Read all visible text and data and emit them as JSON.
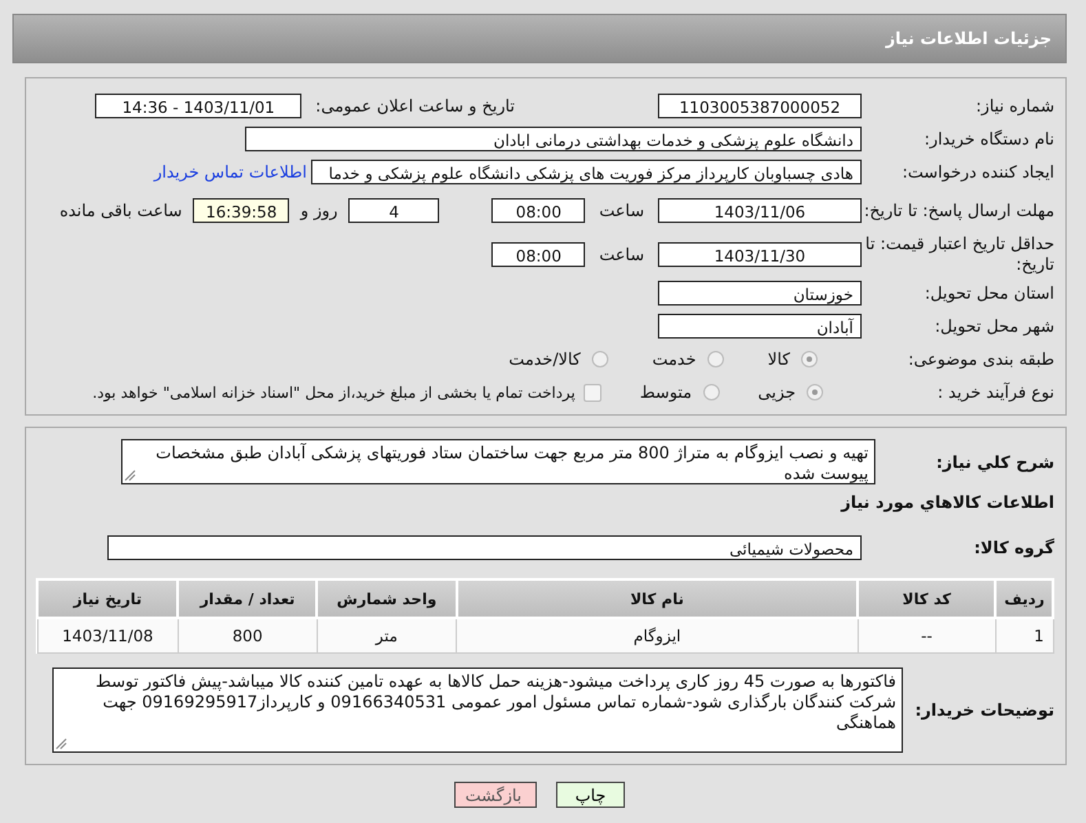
{
  "header": {
    "title": "جزئیات اطلاعات نیاز"
  },
  "need_number": {
    "label": "شماره نیاز:",
    "value": "1103005387000052"
  },
  "announce": {
    "label": "تاریخ و ساعت اعلان عمومی:",
    "value": "1403/11/01 - 14:36"
  },
  "buyer_org": {
    "label": "نام دستگاه خریدار:",
    "value": "دانشگاه علوم پزشکی و خدمات بهداشتی  درمانی ابادان"
  },
  "requester": {
    "label": "ایجاد کننده درخواست:",
    "value": "هادی چسباوبان کارپرداز مرکز فوریت های پزشکی دانشگاه علوم پزشکی و خدما",
    "link": "اطلاعات تماس خریدار"
  },
  "reply_deadline": {
    "label": "مهلت ارسال پاسخ: تا تاریخ:",
    "date": "1403/11/06",
    "time_label": "ساعت",
    "time": "08:00",
    "days": "4",
    "days_label": "روز و",
    "remaining": "16:39:58",
    "remaining_label": "ساعت باقی مانده"
  },
  "price_validity": {
    "label": "حداقل تاریخ اعتبار قیمت: تا تاریخ:",
    "date": "1403/11/30",
    "time_label": "ساعت",
    "time": "08:00"
  },
  "province": {
    "label": "استان محل تحویل:",
    "value": "خوزستان"
  },
  "city": {
    "label": "شهر محل تحویل:",
    "value": "آبادان"
  },
  "category": {
    "label": "طبقه بندی موضوعی:",
    "options": [
      {
        "label": "کالا",
        "selected": true
      },
      {
        "label": "خدمت",
        "selected": false
      },
      {
        "label": "کالا/خدمت",
        "selected": false
      }
    ]
  },
  "process": {
    "label": "نوع فرآیند خرید :",
    "options": [
      {
        "label": "جزیی",
        "selected": true
      },
      {
        "label": "متوسط",
        "selected": false
      }
    ],
    "payment": {
      "checked": false,
      "text": "پرداخت تمام یا بخشی از مبلغ خرید،از محل \"اسناد خزانه اسلامی\" خواهد بود."
    }
  },
  "description": {
    "label": "شرح کلي نیاز:",
    "value": "تهیه و نصب ایزوگام به متراژ 800 متر مربع جهت ساختمان ستاد فوریتهای پزشکی آبادان طبق مشخصات پیوست شده"
  },
  "goods_heading": "اطلاعات کالاهاي مورد نیاز",
  "goods_group": {
    "label": "گروه کالا:",
    "value": "محصولات شیمیائی"
  },
  "table": {
    "columns": [
      "ردیف",
      "کد کالا",
      "نام کالا",
      "واحد شمارش",
      "تعداد / مقدار",
      "تاریخ نیاز"
    ],
    "rows": [
      [
        "1",
        "--",
        "ایزوگام",
        "متر",
        "800",
        "1403/11/08"
      ]
    ]
  },
  "buyer_notes": {
    "label": "توضیحات خریدار:",
    "value": "فاکتورها به صورت 45 روز کاری پرداخت میشود-هزینه حمل کالاها به عهده تامین کننده کالا میباشد-پیش فاکتور توسط شرکت کنندگان بارگذاری شود-شماره تماس مسئول امور عمومی 09166340531 و کارپرداز09169295917 جهت هماهنگی"
  },
  "buttons": [
    {
      "label": "چاپ",
      "kind": "print"
    },
    {
      "label": "بازگشت",
      "kind": "back"
    }
  ]
}
